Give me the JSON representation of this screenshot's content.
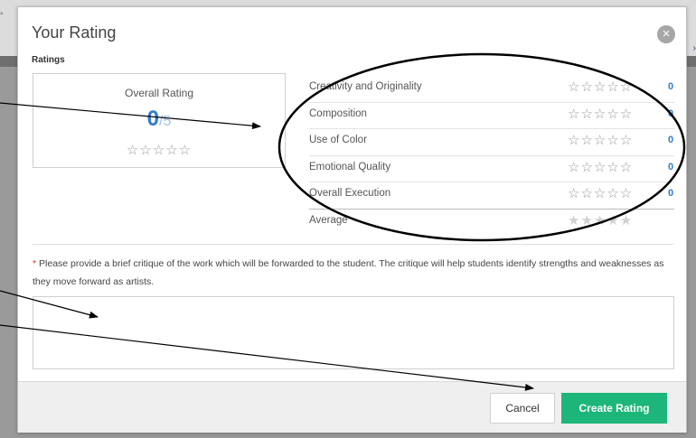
{
  "modal": {
    "title": "Your Rating",
    "close_icon": "×",
    "section_label": "Ratings"
  },
  "overall": {
    "label": "Overall Rating",
    "score": "0",
    "out_of": "/5",
    "stars": "☆☆☆☆☆",
    "star_value": 0
  },
  "criteria": [
    {
      "label": "Creativity and Originality",
      "stars": "☆☆☆☆☆",
      "value": "0"
    },
    {
      "label": "Composition",
      "stars": "☆☆☆☆☆",
      "value": "0"
    },
    {
      "label": "Use of Color",
      "stars": "☆☆☆☆☆",
      "value": "0"
    },
    {
      "label": "Emotional Quality",
      "stars": "☆☆☆☆☆",
      "value": "0"
    },
    {
      "label": "Overall Execution",
      "stars": "☆☆☆☆☆",
      "value": "0"
    }
  ],
  "average": {
    "label": "Average",
    "stars": "★★★★★",
    "star_value": 0
  },
  "critique": {
    "required_mark": "*",
    "instructions": "Please provide a brief critique of the work which will be forwarded to the student. The critique will help students identify strengths and weaknesses as they move forward as artists.",
    "value": ""
  },
  "footer": {
    "cancel_label": "Cancel",
    "create_label": "Create Rating"
  },
  "colors": {
    "accent": "#2f7bd3",
    "primary_button": "#1db67a",
    "required": "#d9342b"
  }
}
